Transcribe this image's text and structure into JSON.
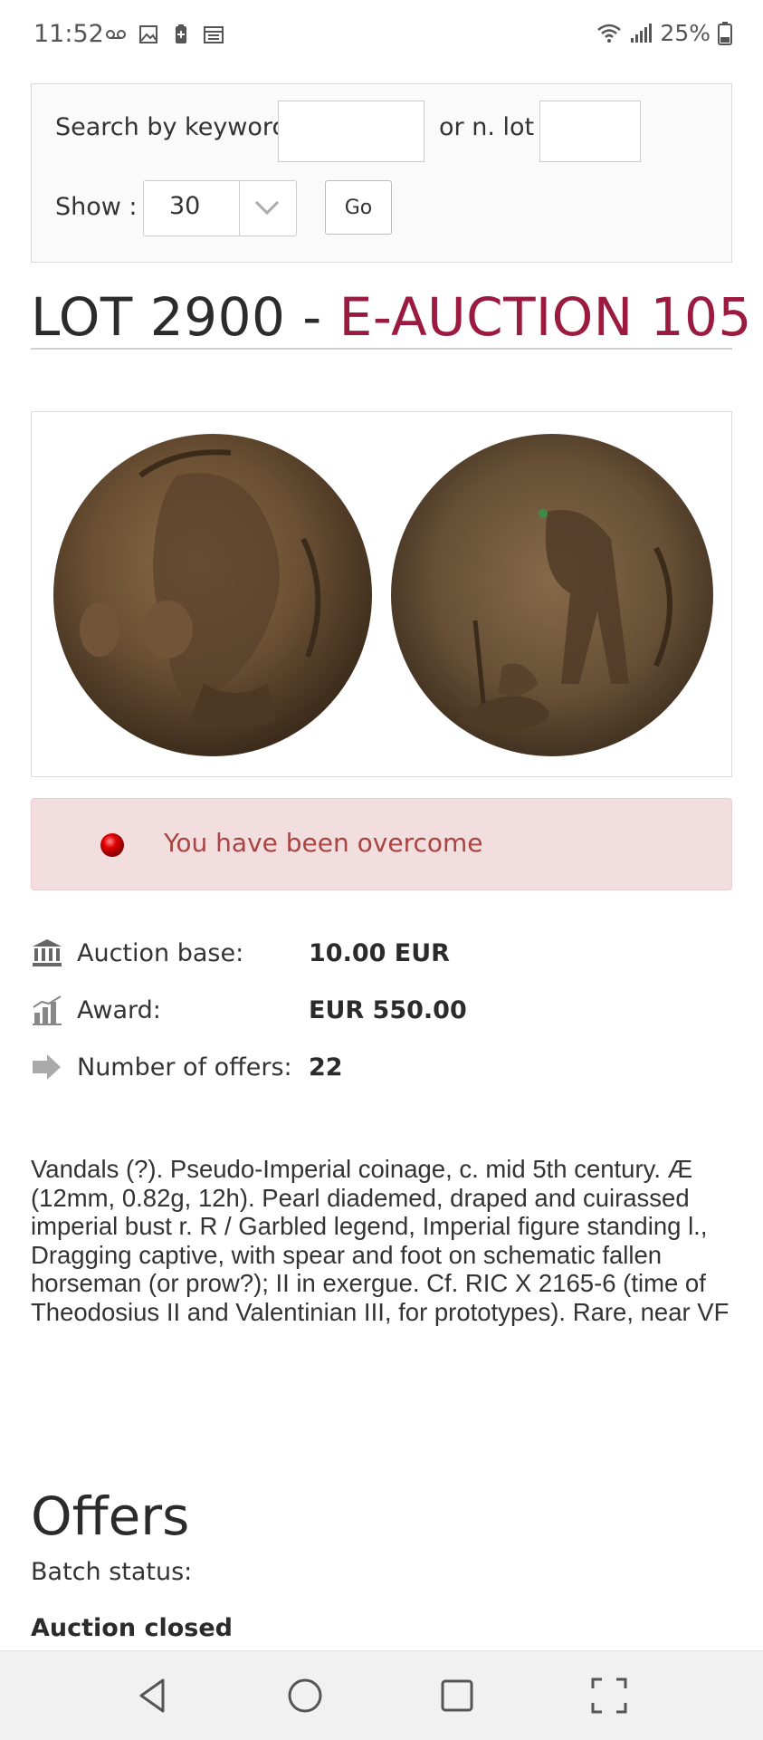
{
  "status_bar": {
    "time": "11:52",
    "battery_percent": "25%",
    "left_icons": [
      "voicemail-icon",
      "image-icon",
      "battery-saver-icon",
      "calendar-icon"
    ],
    "right_icons": [
      "wifi-icon",
      "signal-icon",
      "battery-icon"
    ]
  },
  "search": {
    "keyword_label": "Search by keyword",
    "keyword_value": "",
    "lot_label": "or n. lot",
    "lot_value": "",
    "show_label": "Show :",
    "show_value": "30",
    "go_label": "Go"
  },
  "lot": {
    "prefix": "LOT 2900 - ",
    "auction": "E-AUCTION 105"
  },
  "alert": {
    "message": "You have been overcome"
  },
  "info": [
    {
      "icon": "bank-icon",
      "label": "Auction base:",
      "value": "10.00 EUR"
    },
    {
      "icon": "chart-icon",
      "label": "Award:",
      "value": "EUR 550.00"
    },
    {
      "icon": "arrow-right-icon",
      "label": "Number of offers:",
      "value": "22"
    }
  ],
  "description": "Vandals (?). Pseudo-Imperial coinage, c. mid 5th century. Æ (12mm, 0.82g, 12h). Pearl diademed, draped and cuirassed imperial bust r. R / Garbled legend, Imperial figure standing l., Dragging captive, with spear and foot on schematic fallen horseman (or prow?); II in exergue. Cf. RIC X 2165-6 (time of Theodosius II and Valentinian III, for prototypes). Rare, near VF",
  "offers": {
    "title": "Offers",
    "batch_status_label": "Batch status:",
    "batch_status_value": "Auction closed"
  },
  "colors": {
    "auction_accent": "#9b1a3f",
    "alert_bg": "#f2dede",
    "alert_text": "#a94442"
  }
}
